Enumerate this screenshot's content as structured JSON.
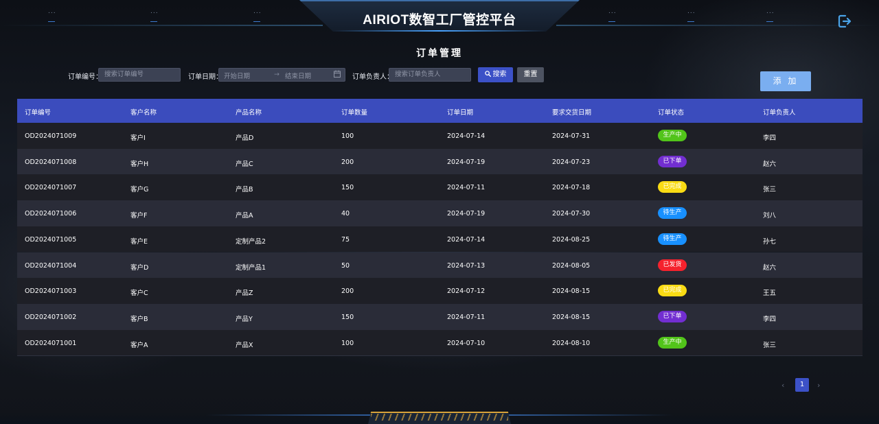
{
  "app": {
    "title": "AIRIOT数智工厂管控平台"
  },
  "header": {
    "dots": "...",
    "icons": {
      "logout": "logout-icon"
    },
    "accent_color": "#4aa3ff"
  },
  "page": {
    "title": "订单管理"
  },
  "filters": {
    "order_no_label": "订单编号：",
    "order_no_placeholder": "搜索订单编号",
    "date_label": "订单日期：",
    "start_placeholder": "开始日期",
    "end_placeholder": "结束日期",
    "owner_label": "订单负责人：",
    "owner_placeholder": "搜索订单负责人",
    "search_label": "搜索",
    "reset_label": "重置",
    "icons": {
      "search": "search-icon",
      "calendar": "calendar-icon",
      "arrow": "arrow-right-icon"
    }
  },
  "actions": {
    "add_label": "添 加"
  },
  "table": {
    "columns": [
      "订单编号",
      "客户名称",
      "产品名称",
      "订单数量",
      "订单日期",
      "要求交货日期",
      "订单状态",
      "订单负责人"
    ],
    "rows": [
      {
        "order_no": "OD2024071009",
        "customer": "客户I",
        "product": "产品D",
        "qty": "100",
        "order_date": "2024-07-14",
        "due_date": "2024-07-31",
        "status": "生产中",
        "owner": "李四"
      },
      {
        "order_no": "OD2024071008",
        "customer": "客户H",
        "product": "产品C",
        "qty": "200",
        "order_date": "2024-07-19",
        "due_date": "2024-07-23",
        "status": "已下单",
        "owner": "赵六"
      },
      {
        "order_no": "OD2024071007",
        "customer": "客户G",
        "product": "产品B",
        "qty": "150",
        "order_date": "2024-07-11",
        "due_date": "2024-07-18",
        "status": "已完成",
        "owner": "张三"
      },
      {
        "order_no": "OD2024071006",
        "customer": "客户F",
        "product": "产品A",
        "qty": "40",
        "order_date": "2024-07-19",
        "due_date": "2024-07-30",
        "status": "待生产",
        "owner": "刘八"
      },
      {
        "order_no": "OD2024071005",
        "customer": "客户E",
        "product": "定制产品2",
        "qty": "75",
        "order_date": "2024-07-14",
        "due_date": "2024-08-25",
        "status": "待生产",
        "owner": "孙七"
      },
      {
        "order_no": "OD2024071004",
        "customer": "客户D",
        "product": "定制产品1",
        "qty": "50",
        "order_date": "2024-07-13",
        "due_date": "2024-08-05",
        "status": "已发货",
        "owner": "赵六"
      },
      {
        "order_no": "OD2024071003",
        "customer": "客户C",
        "product": "产品Z",
        "qty": "200",
        "order_date": "2024-07-12",
        "due_date": "2024-08-15",
        "status": "已完成",
        "owner": "王五"
      },
      {
        "order_no": "OD2024071002",
        "customer": "客户B",
        "product": "产品Y",
        "qty": "150",
        "order_date": "2024-07-11",
        "due_date": "2024-08-15",
        "status": "已下单",
        "owner": "李四"
      },
      {
        "order_no": "OD2024071001",
        "customer": "客户A",
        "product": "产品X",
        "qty": "100",
        "order_date": "2024-07-10",
        "due_date": "2024-08-10",
        "status": "生产中",
        "owner": "张三"
      }
    ],
    "status_colors": {
      "生产中": "#52c41a",
      "已下单": "#722ed1",
      "已完成": "#fadb14",
      "待生产": "#1890ff",
      "已发货": "#f5222d"
    }
  },
  "pagination": {
    "prev": "‹",
    "current": "1",
    "next": "›"
  }
}
